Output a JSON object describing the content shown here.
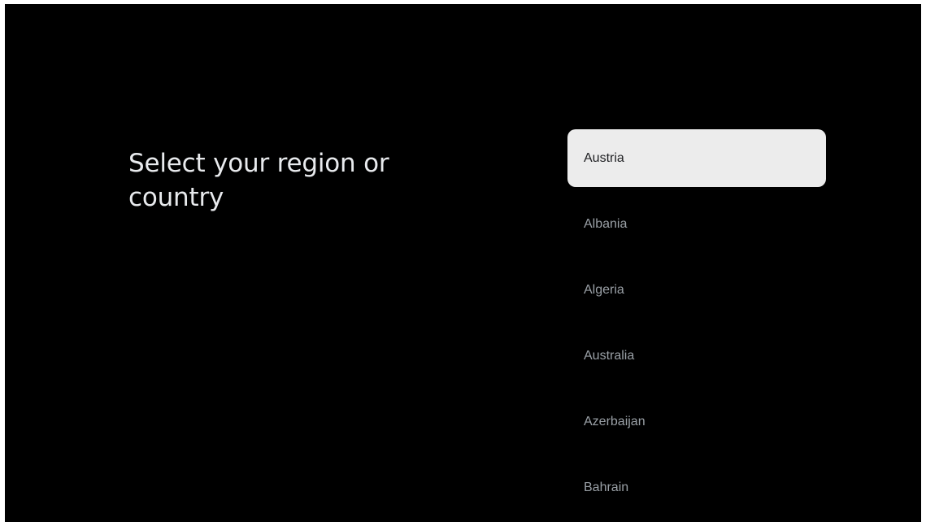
{
  "page": {
    "title": "Select your region or country"
  },
  "region_list": {
    "focused_index": 0,
    "items": [
      {
        "label": "Austria"
      },
      {
        "label": "Albania"
      },
      {
        "label": "Algeria"
      },
      {
        "label": "Australia"
      },
      {
        "label": "Azerbaijan"
      },
      {
        "label": "Bahrain"
      }
    ]
  },
  "colors": {
    "background": "#000000",
    "title_text": "#e8eaed",
    "item_text": "#9aa0a6",
    "focused_background": "#ececec",
    "focused_text": "#202124"
  }
}
